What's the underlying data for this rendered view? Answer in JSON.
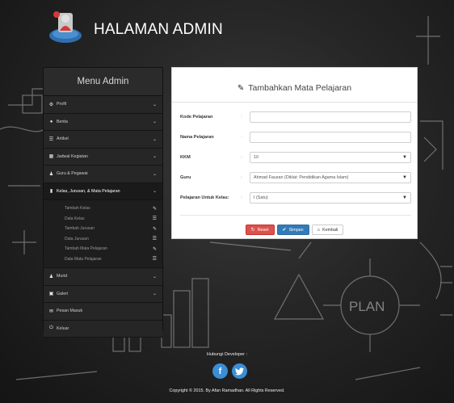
{
  "header": {
    "title": "HALAMAN ADMIN"
  },
  "sidebar": {
    "title": "Menu Admin",
    "items": [
      {
        "label": "Profil",
        "icon": "gear-icon"
      },
      {
        "label": "Berita",
        "icon": "globe-icon"
      },
      {
        "label": "Artikel",
        "icon": "list-icon"
      },
      {
        "label": "Jadwal Kegiatan",
        "icon": "calendar-icon"
      },
      {
        "label": "Guru & Pegawai",
        "icon": "user-icon"
      },
      {
        "label": "Kelas, Jurusan, & Mata Pelajaran",
        "icon": "bookmark-icon"
      }
    ],
    "subitems": [
      {
        "label": "Tambah Kelas",
        "icon": "pencil-icon"
      },
      {
        "label": "Data Kelas",
        "icon": "list-icon"
      },
      {
        "label": "Tambah Jurusan",
        "icon": "pencil-icon"
      },
      {
        "label": "Data Jurusan",
        "icon": "list-icon"
      },
      {
        "label": "Tambah Mata Pelajaran",
        "icon": "pencil-icon"
      },
      {
        "label": "Data Mata Pelajaran",
        "icon": "list-icon"
      }
    ],
    "items_after": [
      {
        "label": "Murid",
        "icon": "user-icon"
      },
      {
        "label": "Galeri",
        "icon": "image-icon"
      },
      {
        "label": "Pesan Masuk",
        "icon": "inbox-icon"
      },
      {
        "label": "Keluar",
        "icon": "power-icon"
      }
    ]
  },
  "form": {
    "title": "Tambahkan Mata Pelajaran",
    "fields": [
      {
        "label": "Kode Pelajaran",
        "value": ""
      },
      {
        "label": "Nama Pelajaran",
        "value": ""
      },
      {
        "label": "KKM",
        "value": "10"
      },
      {
        "label": "Guru",
        "value": "Ahmad Fauzan (Diklat: Pendidikan Agama Islam)"
      },
      {
        "label": "Pelajaran Untuk Kelas:",
        "value": "I (Satu)"
      }
    ],
    "colon": ":",
    "buttons": {
      "reset": "Reset",
      "save": "Simpan",
      "back": "Kembali"
    }
  },
  "footer": {
    "contact": "Hubungi Developer :",
    "copyright": "Copyright © 2015. By Afan Ramadhan. All Rights Reserved."
  },
  "colors": {
    "reset": "#d9534f",
    "save": "#337ab7",
    "social": "#3b8ed6"
  }
}
